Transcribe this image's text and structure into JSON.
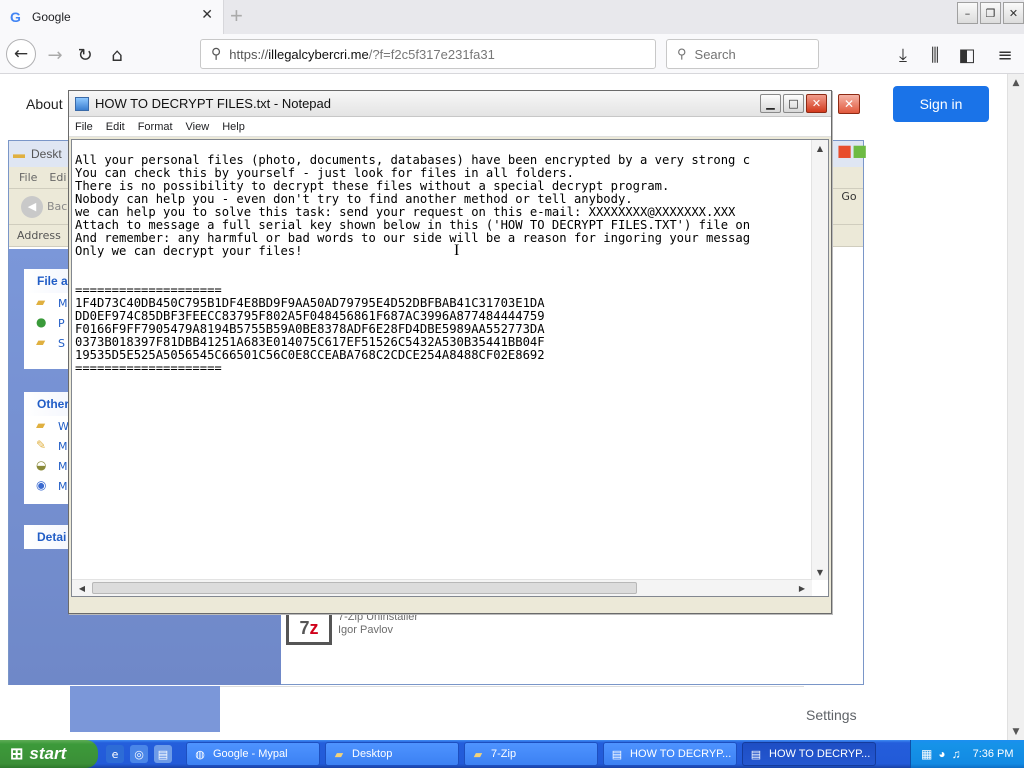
{
  "browser": {
    "tab_title": "Google",
    "tab_logo": "G",
    "new_tab_symbol": "+",
    "url_prefix": "https://",
    "url_host": "illegalcybercri.me",
    "url_path": "/?f=f2c5f317e231fa31",
    "search_placeholder": "Search",
    "window_buttons": [
      "–",
      "❐",
      "✕"
    ]
  },
  "page": {
    "about_label": "About",
    "signin_label": "Sign in",
    "settings_label": "Settings",
    "accent_color": "#1a73e8"
  },
  "explorer": {
    "title": "Deskt",
    "menu": [
      "File",
      "Edi"
    ],
    "back_label": "Bac",
    "address_label": "Address",
    "go_label": "Go",
    "panels": [
      {
        "header": "File a",
        "items": [
          "M",
          "P W",
          "S"
        ]
      },
      {
        "header": "Other",
        "items": [
          "W",
          "M",
          "M",
          "M"
        ]
      },
      {
        "header": "Detai",
        "items": []
      }
    ],
    "zip_name": "7-Zip Uninstaller",
    "zip_publisher": "Igor Pavlov"
  },
  "notepad": {
    "title": "HOW TO DECRYPT FILES.txt - Notepad",
    "menu": [
      "File",
      "Edit",
      "Format",
      "View",
      "Help"
    ],
    "lines": [
      "All your personal files (photo, documents, databases) have been encrypted by a very strong c",
      "You can check this by yourself - just look for files in all folders.",
      "There is no possibility to decrypt these files without a special decrypt program.",
      "Nobody can help you - even don't try to find another method or tell anybody.",
      "we can help you to solve this task: send your request on this e-mail: XXXXXXXX@XXXXXXX.XXX",
      "Attach to message a full serial key shown below in this ('HOW TO DECRYPT FILES.TXT') file on",
      "And remember: any harmful or bad words to our side will be a reason for ingoring your messag",
      "Only we can decrypt your files!",
      "",
      "",
      "====================",
      "1F4D73C40DB450C795B1DF4E8BD9F9AA50AD79795E4D52DBFBAB41C31703E1DA",
      "DD0EF974C85DBF3FEECC83795F802A5F048456861F687AC3996A877484444759",
      "F0166F9FF7905479A8194B5755B59A0BE8378ADF6E28FD4DBE5989AA552773DA",
      "0373B018397F81DBB41251A683E014075C617EF51526C5432A530B35441BB04F",
      "19535D5E525A5056545C66501C56C0E8CCEABA768C2CDCE254A8488CF02E8692",
      "===================="
    ]
  },
  "taskbar": {
    "start_label": "start",
    "tasks": [
      {
        "label": "Google - Mypal",
        "icon": "browser-icon"
      },
      {
        "label": "Desktop",
        "icon": "folder-icon"
      },
      {
        "label": "7-Zip",
        "icon": "folder-icon"
      },
      {
        "label": "HOW TO DECRYP...",
        "icon": "notepad-icon"
      },
      {
        "label": "HOW TO DECRYP...",
        "icon": "notepad-icon"
      }
    ],
    "clock": "7:36 PM"
  }
}
